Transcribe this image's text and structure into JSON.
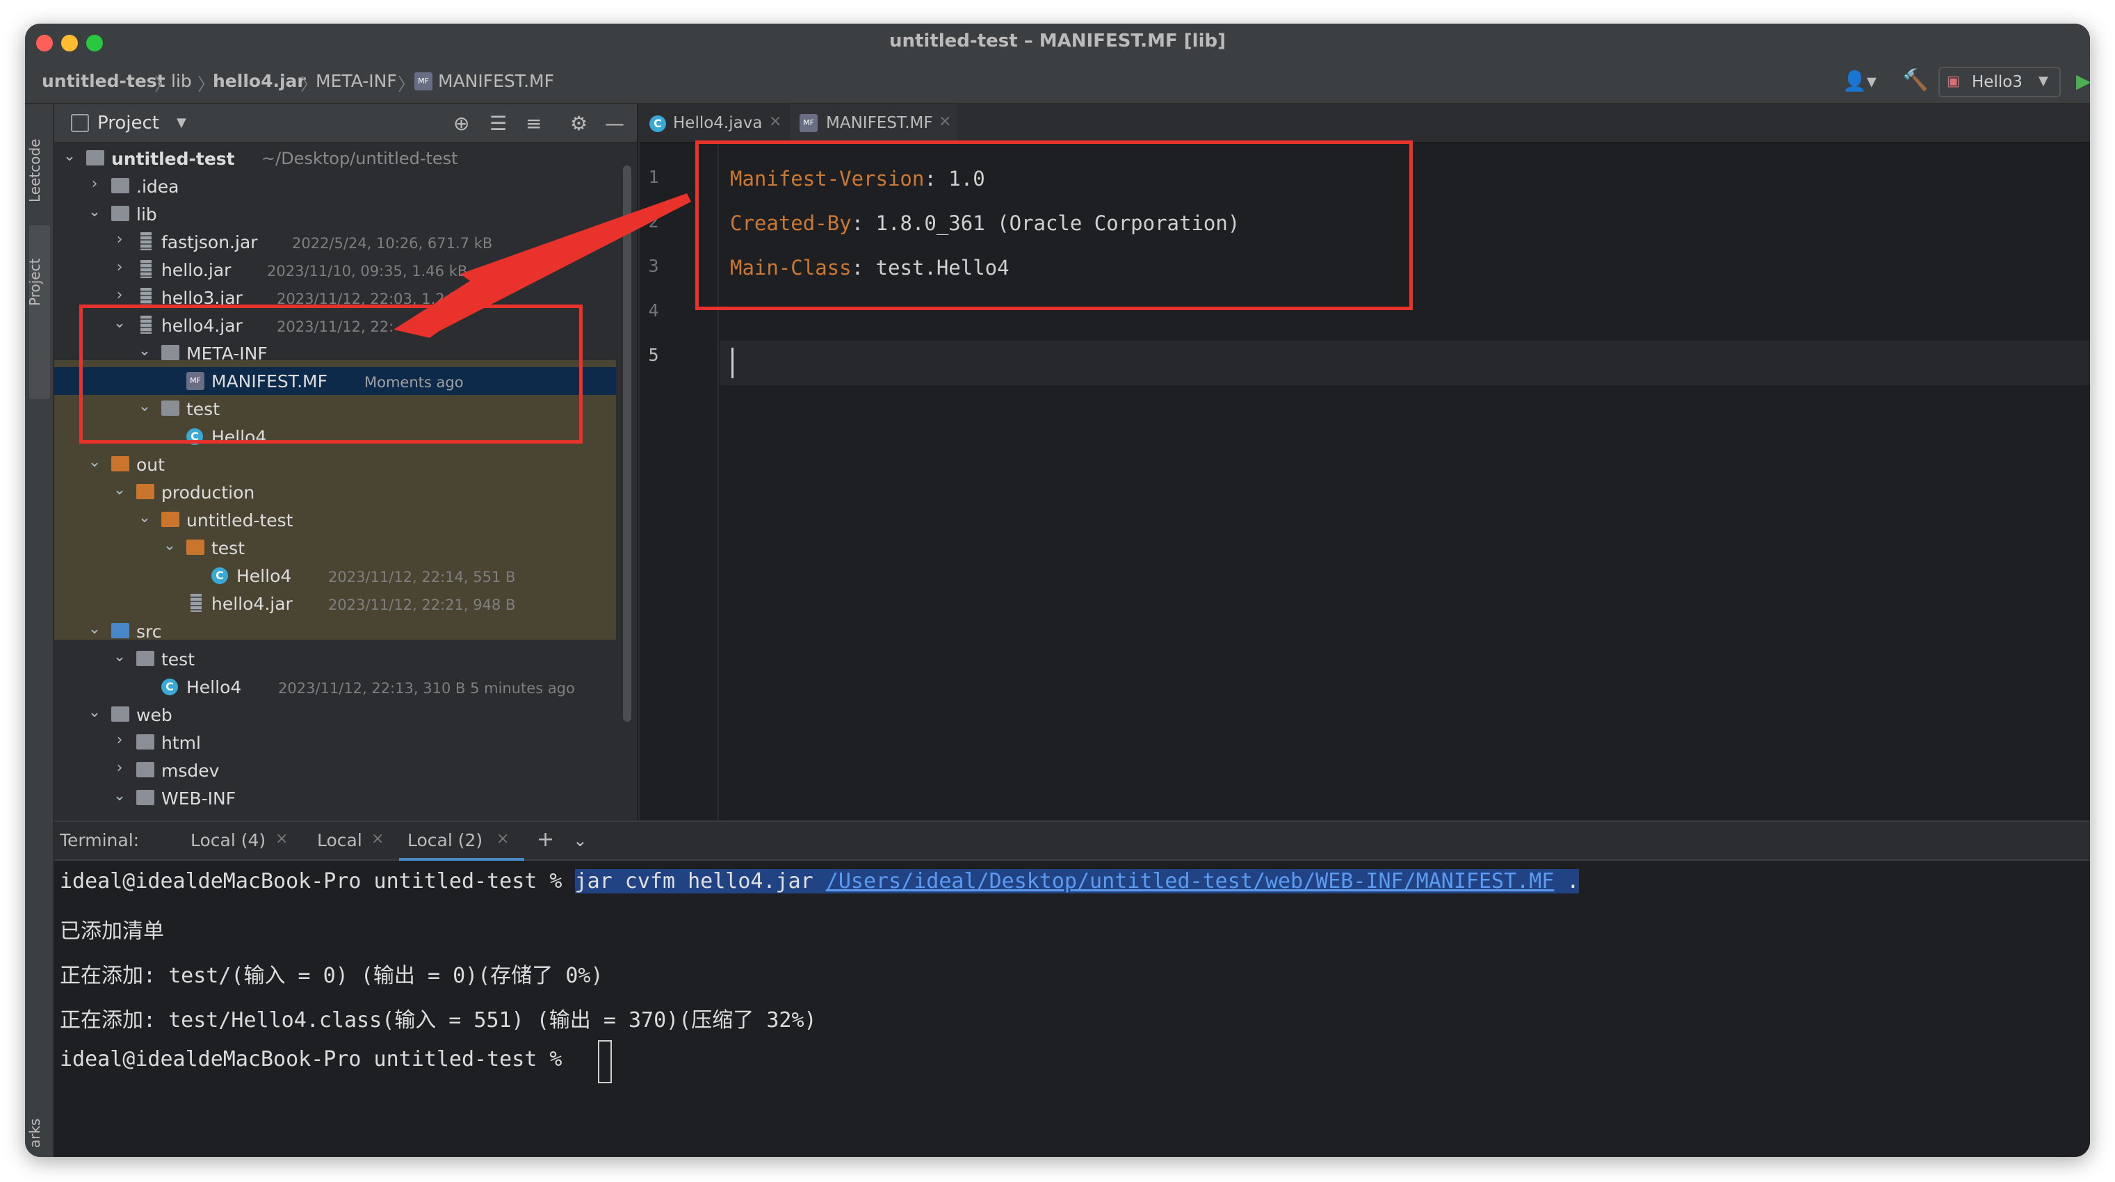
{
  "window": {
    "title": "untitled-test – MANIFEST.MF [lib]"
  },
  "breadcrumb": [
    "untitled-test",
    "lib",
    "hello4.jar",
    "META-INF",
    "MANIFEST.MF"
  ],
  "toolbar": {
    "run_config": "Hello3"
  },
  "side_strip": {
    "top": "Leetcode",
    "project": "Project",
    "bottom": "arks"
  },
  "project_panel": {
    "title": "Project",
    "root": {
      "name": "untitled-test",
      "path": "~/Desktop/untitled-test"
    },
    "items": [
      {
        "name": ".idea",
        "meta": ""
      },
      {
        "name": "lib",
        "meta": ""
      },
      {
        "name": "fastjson.jar",
        "meta": "2022/5/24, 10:26, 671.7 kB"
      },
      {
        "name": "hello.jar",
        "meta": "2023/11/10, 09:35, 1.46 kB"
      },
      {
        "name": "hello3.jar",
        "meta": "2023/11/12, 22:03, 1.2 kB"
      },
      {
        "name": "hello4.jar",
        "meta": "2023/11/12, 22:"
      },
      {
        "name": "META-INF",
        "meta": ""
      },
      {
        "name": "MANIFEST.MF",
        "meta": "Moments ago"
      },
      {
        "name": "test",
        "meta": ""
      },
      {
        "name": "Hello4",
        "meta": ""
      },
      {
        "name": "out",
        "meta": ""
      },
      {
        "name": "production",
        "meta": ""
      },
      {
        "name": "untitled-test",
        "meta": ""
      },
      {
        "name": "test",
        "meta": ""
      },
      {
        "name": "Hello4",
        "meta": "2023/11/12, 22:14, 551 B"
      },
      {
        "name": "hello4.jar",
        "meta": "2023/11/12, 22:21, 948 B"
      },
      {
        "name": "src",
        "meta": ""
      },
      {
        "name": "test",
        "meta": ""
      },
      {
        "name": "Hello4",
        "meta": "2023/11/12, 22:13, 310 B 5 minutes ago"
      },
      {
        "name": "web",
        "meta": ""
      },
      {
        "name": "html",
        "meta": ""
      },
      {
        "name": "msdev",
        "meta": ""
      },
      {
        "name": "WEB-INF",
        "meta": ""
      }
    ]
  },
  "editor": {
    "tabs": [
      "Hello4.java",
      "MANIFEST.MF"
    ],
    "active_tab": "MANIFEST.MF",
    "line_numbers": [
      "1",
      "2",
      "3",
      "4",
      "5"
    ],
    "lines": [
      {
        "key": "Manifest-Version",
        "value": ": 1.0"
      },
      {
        "key": "Created-By",
        "value": ": 1.8.0_361 (Oracle Corporation)"
      },
      {
        "key": "Main-Class",
        "value": ": test.Hello4"
      }
    ]
  },
  "terminal": {
    "label": "Terminal:",
    "tabs": [
      "Local (4)",
      "Local",
      "Local (2)"
    ],
    "active_tab": "Local (2)",
    "prompt": "ideal@idealdeMacBook-Pro untitled-test % ",
    "command_prefix": "jar cvfm hello4.jar ",
    "command_path": "/Users/ideal/Desktop/untitled-test/web/WEB-INF/MANIFEST.MF",
    "command_suffix": " .",
    "output": [
      "已添加清单",
      "正在添加: test/(输入 = 0) (输出 = 0)(存储了 0%)",
      "正在添加: test/Hello4.class(输入 = 551) (输出 = 370)(压缩了 32%)"
    ]
  },
  "colors": {
    "accent": "#4a88c7",
    "annotation": "#e8322b",
    "keyword": "#cc7832"
  }
}
